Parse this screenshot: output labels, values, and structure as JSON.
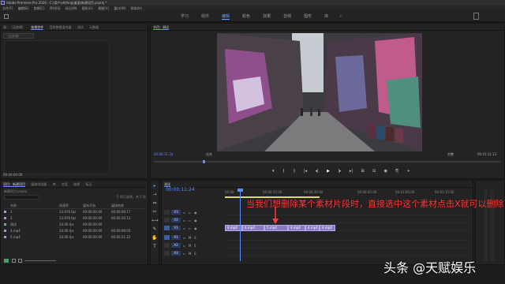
{
  "titlebar": {
    "title": "Adobe Premiere Pro 2020 - C:\\用户\\shifeng\\桌面\\新建项目.prproj *"
  },
  "menubar": {
    "items": [
      "文件(F)",
      "编辑(E)",
      "剪辑(C)",
      "序列(S)",
      "标记(M)",
      "图形(G)",
      "视图(V)",
      "窗口(W)",
      "帮助(H)"
    ]
  },
  "workspace": {
    "tabs": [
      "学习",
      "组件",
      "编辑",
      "颜色",
      "效果",
      "音频",
      "图形",
      "库"
    ],
    "active": "编辑",
    "more": "»"
  },
  "source_panel": {
    "tabs": [
      "源：（无剪辑）",
      "效果控件",
      "音频剪辑混合器",
      "测试",
      "元数据"
    ],
    "dropdown": "（无剪辑）",
    "timecode": "00:00:00:00"
  },
  "program_panel": {
    "title": "节目：测试",
    "timecode_left": "00:00:11:24",
    "fit": "适合",
    "full": "完整",
    "timecode_right": "00:01:11:12"
  },
  "transport": {
    "buttons": [
      "▾",
      "{",
      "}",
      "|◂",
      "◂|",
      "▶",
      "|▸",
      "▸|",
      "⊞",
      "⊟",
      "◉",
      "⎘",
      "+"
    ]
  },
  "project_panel": {
    "tabs": [
      "项目：新建项目",
      "媒体浏览器",
      "库",
      "信息",
      "效果",
      "标记"
    ],
    "project_name": "新建项目.prproj",
    "search_placeholder": "",
    "item_count": "5 项已选择，共 5 项",
    "columns": [
      "名称",
      "帧速率",
      "媒体开始",
      "媒体结束"
    ],
    "rows": [
      {
        "name": "1",
        "fps": "23.976 fps",
        "start": "00:00:00:00",
        "end": "00:00:08:17",
        "color": "#a99be0"
      },
      {
        "name": "2",
        "fps": "23.976 fps",
        "start": "00:00:00:00",
        "end": "00:00:26:13",
        "color": "#a99be0"
      },
      {
        "name": "测试",
        "fps": "24.00 fps",
        "start": "00:00:00:00",
        "end": "",
        "color": "#5fb88e"
      },
      {
        "name": "4.mp4",
        "fps": "24.00 fps",
        "start": "00:00:00:00",
        "end": "00:00:08:03",
        "color": "#a99be0"
      },
      {
        "name": "5.mp4",
        "fps": "24.00 fps",
        "start": "00:00:00:00",
        "end": "00:00:21:22",
        "color": "#a99be0"
      }
    ]
  },
  "tools": [
    "▸",
    "⇢",
    "⇔",
    "✂",
    "⟷",
    "✎",
    "✋",
    "T"
  ],
  "timeline": {
    "tab": "测试",
    "timecode": "00:00:11:24",
    "ruler_ticks": [
      "00:00",
      "00:00:15:00",
      "00:00:30:00",
      "00:00:45:00",
      "00:01:00:00",
      "00:01:15:00"
    ],
    "tracks_video": [
      "V3",
      "V2",
      "V1"
    ],
    "tracks_audio": [
      "A1",
      "A2",
      "A3"
    ],
    "clips": [
      "4.mp4",
      "4.mp4",
      "5.mp4",
      "4.mp4",
      "4.mp4",
      "4.mp4"
    ]
  },
  "annotation": {
    "text": "当我们想删除某个素材片段时，直接选中这个素材点击X就可以删除了"
  },
  "watermark": {
    "text": "头条 @天赋娱乐"
  },
  "colors": {
    "accent": "#5d8cff",
    "annotation": "#ff3a3a",
    "clip_video": "#8b7bc6",
    "clip_audio": "#2f6a55"
  }
}
